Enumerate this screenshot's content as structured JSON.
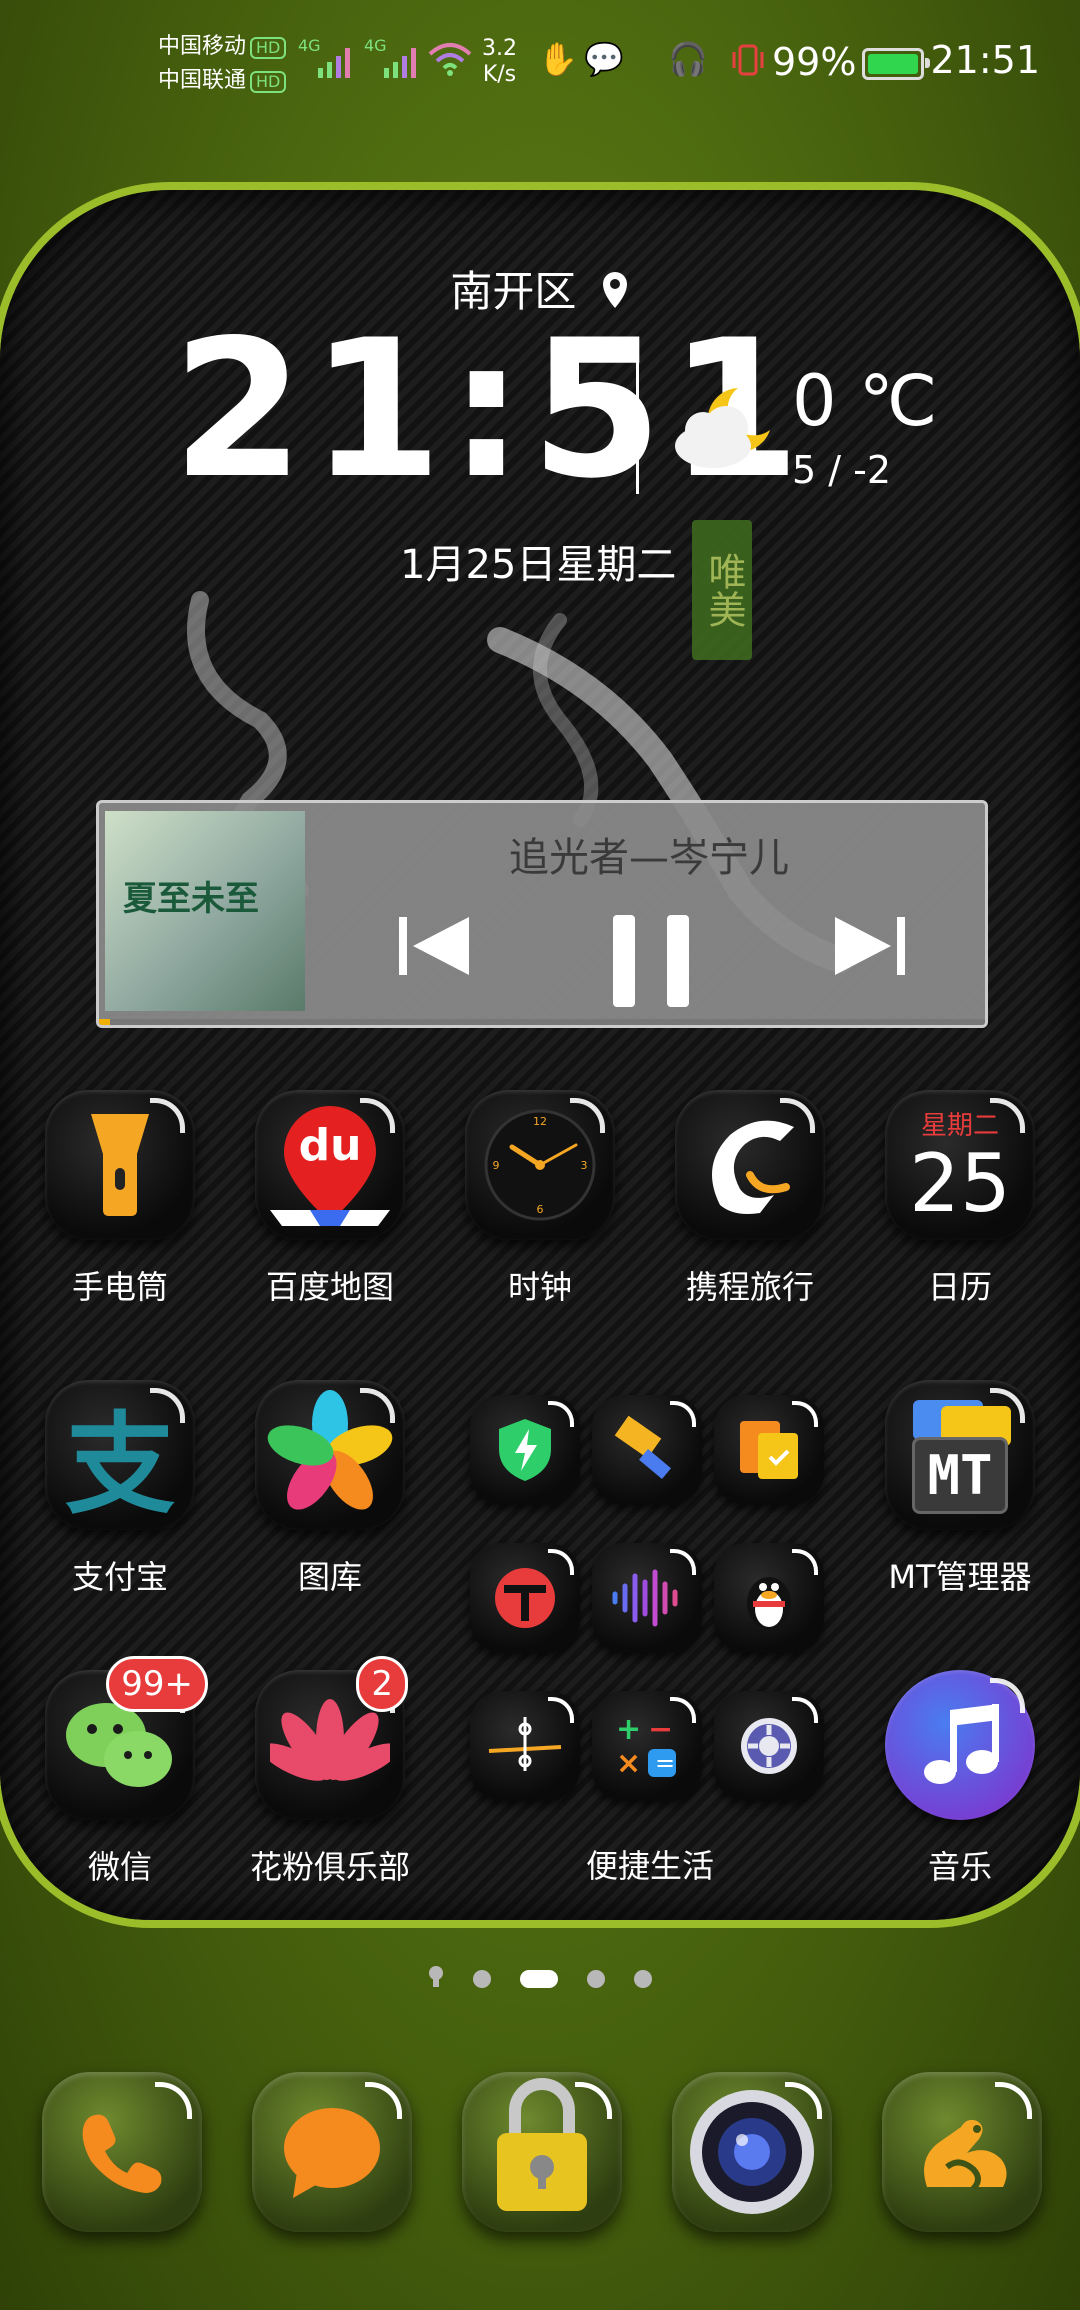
{
  "status_bar": {
    "carrier1": "中国移动",
    "carrier2": "中国联通",
    "hd": "HD",
    "net1": "4G",
    "net2": "4G",
    "speed_value": "3.2",
    "speed_unit": "K/s",
    "battery_percent": "99%",
    "time": "21:51"
  },
  "clock_widget": {
    "location": "南开区",
    "time": "21:51",
    "temperature": "0 ℃",
    "range": "5 / -2",
    "date": "1月25日星期二",
    "seal_text": "唯美"
  },
  "music_widget": {
    "song": "追光者—岑宁儿",
    "cover_text": "夏至未至",
    "progress": 0.01
  },
  "apps": {
    "flashlight": "手电筒",
    "baidu_map": "百度地图",
    "baidu_logo": "du",
    "clock": "时钟",
    "ctrip": "携程旅行",
    "calendar": "日历",
    "calendar_weekday": "星期二",
    "calendar_day": "25",
    "alipay": "支付宝",
    "gallery": "图库",
    "mt_manager": "MT管理器",
    "mt_logo": "MT",
    "wechat": "微信",
    "wechat_badge": "99+",
    "huafen": "花粉俱乐部",
    "huafen_badge": "2",
    "folder": "便捷生活",
    "music": "音乐"
  },
  "pages": {
    "count": 5,
    "active": 2
  },
  "dock": [
    "phone-icon",
    "messages-icon",
    "lock-icon",
    "camera-icon",
    "uc-browser-icon"
  ],
  "colors": {
    "accent_green": "#9bbd2a",
    "badge_red": "#e83b3b",
    "orange": "#f5a623"
  }
}
